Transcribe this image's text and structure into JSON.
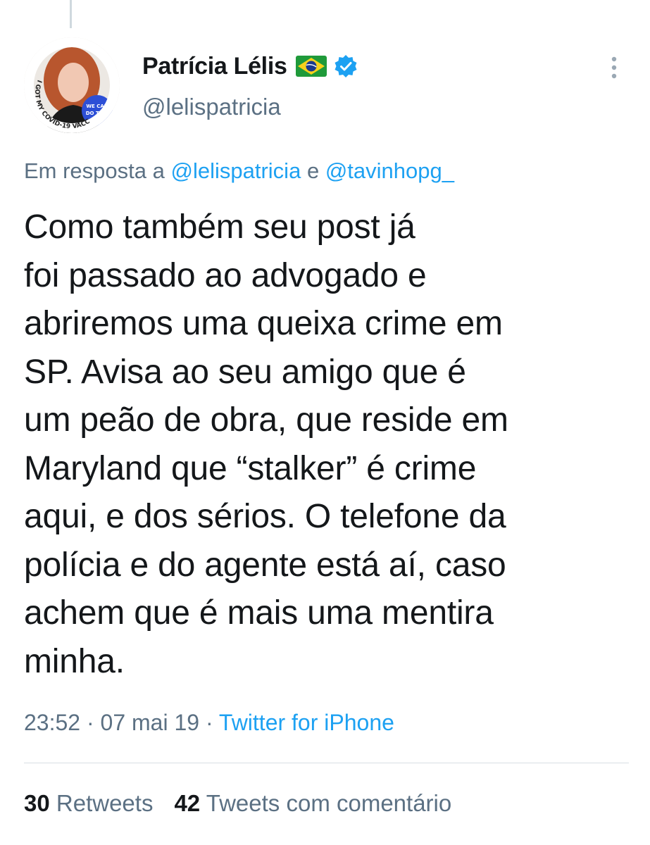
{
  "tweet": {
    "author": {
      "display_name": "Patrícia Lélis",
      "flag_icon": "brazil-flag-icon",
      "verified_icon": "verified-badge-icon",
      "handle": "@lelispatricia",
      "avatar_badge_text": "I GOT MY COVID-19 VACCINE",
      "avatar_badge_inner": "WE CAN DO THIS"
    },
    "reply_to": {
      "prefix": "Em resposta a",
      "mention_1": "@lelispatricia",
      "conjunction": "e",
      "mention_2": "@tavinhopg_"
    },
    "text": "Como também seu post já\nfoi passado ao advogado e\nabriremos uma queixa crime em\nSP. Avisa ao seu amigo que é\num  peão de obra, que reside em\nMaryland que “stalker” é crime\naqui, e dos sérios. O telefone da\npolícia e do agente está aí, caso\nachem que é mais uma mentira\nminha.",
    "time": "23:52",
    "separator": "·",
    "date": "07 mai 19",
    "source": "Twitter for iPhone",
    "stats": {
      "retweets_count": "30",
      "retweets_label": "Retweets",
      "quote_count": "42",
      "quote_label": "Tweets com comentário"
    }
  },
  "colors": {
    "link": "#1da1f2",
    "secondary_text": "#5b7083",
    "primary_text": "#14171a",
    "divider": "#d8dee3"
  }
}
